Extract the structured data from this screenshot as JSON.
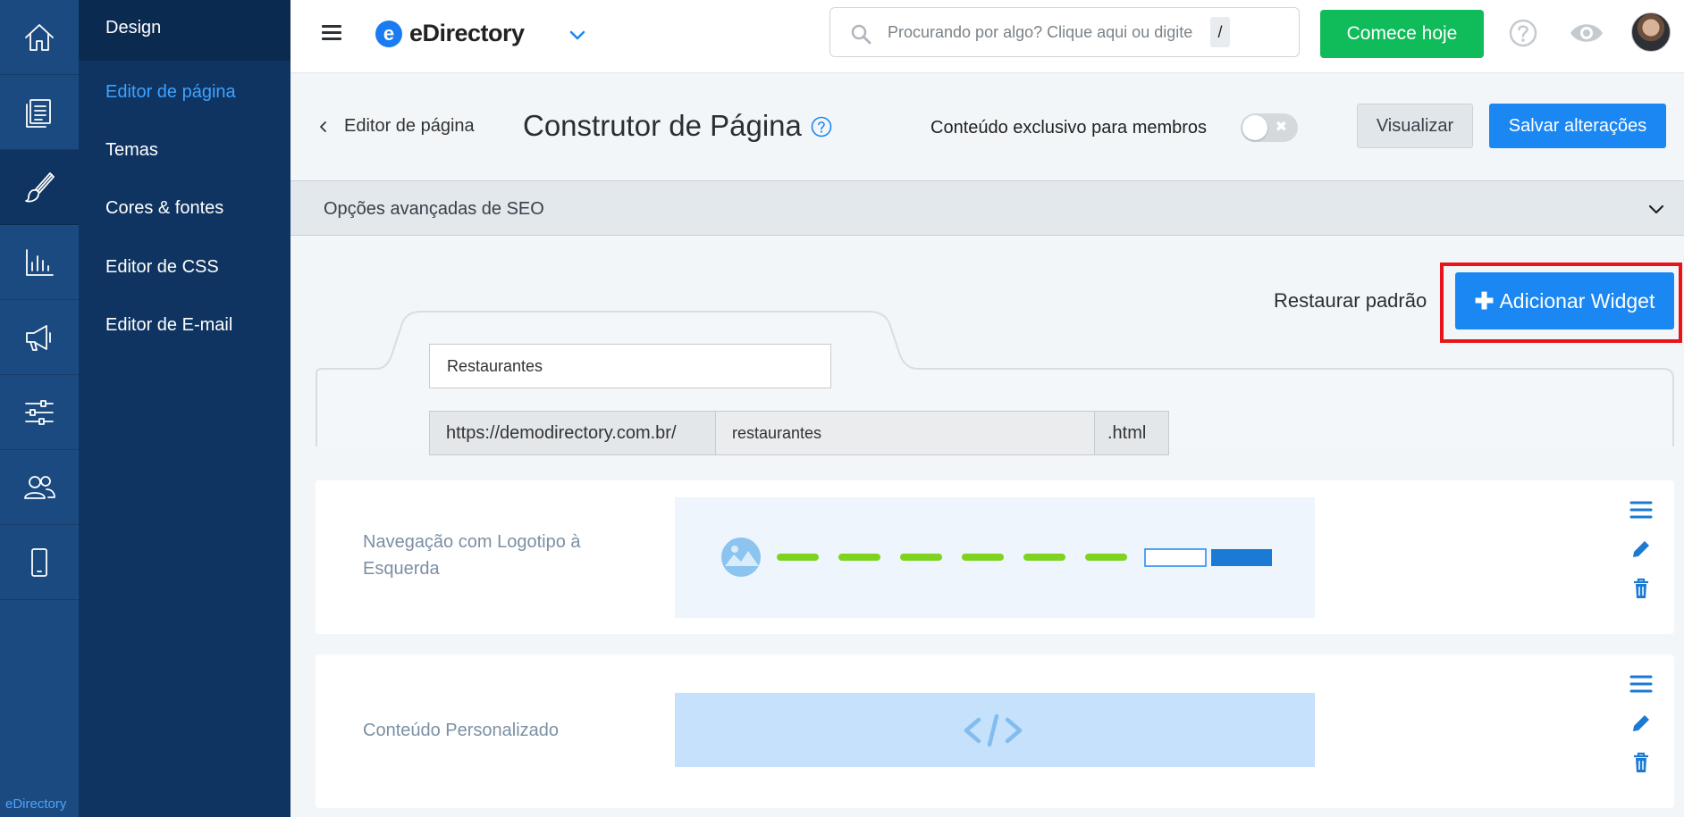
{
  "rail": {
    "items": [
      {
        "name": "home-icon"
      },
      {
        "name": "content-icon"
      },
      {
        "name": "design-icon"
      },
      {
        "name": "reports-icon"
      },
      {
        "name": "marketing-icon"
      },
      {
        "name": "settings-icon"
      },
      {
        "name": "users-icon"
      },
      {
        "name": "mobile-icon"
      }
    ],
    "active_index": 2,
    "brand": "eDirectory"
  },
  "submenu": {
    "title": "Design",
    "items": [
      {
        "label": "Editor de página",
        "active": true
      },
      {
        "label": "Temas"
      },
      {
        "label": "Cores & fontes"
      },
      {
        "label": "Editor de CSS"
      },
      {
        "label": "Editor de E-mail"
      }
    ]
  },
  "topbar": {
    "logo_letter": "e",
    "logo_text": "eDirectory",
    "search_placeholder": "Procurando por algo? Clique aqui ou digite",
    "search_shortcut": "/",
    "cta_label": "Comece hoje"
  },
  "header": {
    "back_label": "Editor de página",
    "title": "Construtor de Página",
    "members_label": "Conteúdo exclusivo para membros",
    "members_toggle": false,
    "toggle_glyph": "✖",
    "view_label": "Visualizar",
    "save_label": "Salvar alterações"
  },
  "seo": {
    "label": "Opções avançadas de SEO"
  },
  "widgets_toolbar": {
    "restore_label": "Restaurar padrão",
    "add_plus": "✚",
    "add_label": "Adicionar Widget"
  },
  "page_form": {
    "name_value": "Restaurantes",
    "url_prefix": "https://demodirectory.com.br/",
    "url_slug": "restaurantes",
    "url_suffix": ".html"
  },
  "widgets": [
    {
      "label": "Navegação com Logotipo à Esquerda",
      "preview": "navigation"
    },
    {
      "label": "Conteúdo Personalizado",
      "preview": "custom-code"
    }
  ],
  "colors": {
    "accent": "#1a87f2",
    "cta": "#10bb5a",
    "highlight": "#e8141a",
    "nav_line": "#7ed321",
    "rail": "#1b4a80",
    "submenu": "#0f3461"
  }
}
